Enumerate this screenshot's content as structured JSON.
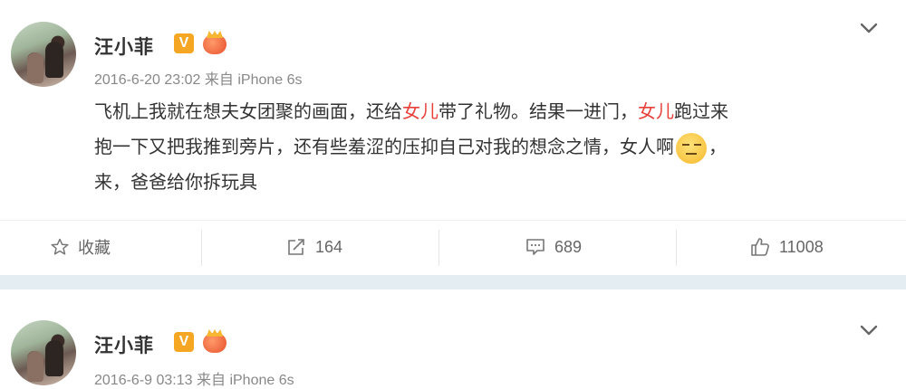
{
  "posts": [
    {
      "username": "汪小菲",
      "verified_label": "V",
      "timestamp": "2016-6-20 23:02",
      "source_prefix": "来自",
      "source": "iPhone 6s",
      "content": {
        "line1": [
          "飞机上我就在想夫女团聚的画面，还给",
          "女儿",
          "带了礼物。结果一进门，",
          "女儿",
          "跑过来"
        ],
        "line2": [
          "抱一下又把我推到旁片，还有些羞涩的压抑自己对我的想念之情，女人啊",
          "，"
        ],
        "line3": "来，爸爸给你拆玩具"
      },
      "actions": {
        "favorite": "收藏",
        "repost": "164",
        "comment": "689",
        "like": "11008"
      }
    },
    {
      "username": "汪小菲",
      "verified_label": "V",
      "timestamp": "2016-6-9 03:13",
      "source_prefix": "来自",
      "source": "iPhone 6s"
    }
  ],
  "colors": {
    "highlight": "#e8413c",
    "separator": "#e4eef2",
    "badge": "#f5a623"
  },
  "icons": [
    "avatar",
    "verified-badge",
    "vip-crown-icon",
    "chevron-down-icon",
    "star-icon",
    "repost-icon",
    "comment-icon",
    "like-icon",
    "emoji-icon"
  ]
}
